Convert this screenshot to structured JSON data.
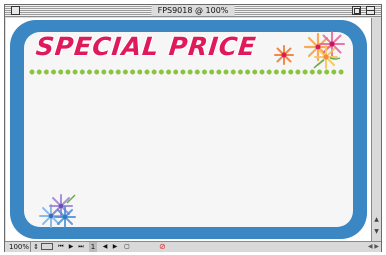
{
  "window": {
    "title": "FPS9018 @ 100%"
  },
  "card": {
    "headline": "SPECIAL PRICE",
    "colors": {
      "border": "#3a87c3",
      "headline": "#e0195a",
      "dots": "#8ac43f",
      "inner": "#f6f6f6"
    }
  },
  "statusbar": {
    "zoom": "100%",
    "page": "1",
    "icons": [
      "zoom-stepper-icon",
      "page-layout-icon",
      "first-page-icon",
      "prev-page-icon",
      "next-page-icon",
      "last-page-icon",
      "prev-spread-icon",
      "next-spread-icon",
      "page-view-icon",
      "no-entry-icon"
    ]
  }
}
